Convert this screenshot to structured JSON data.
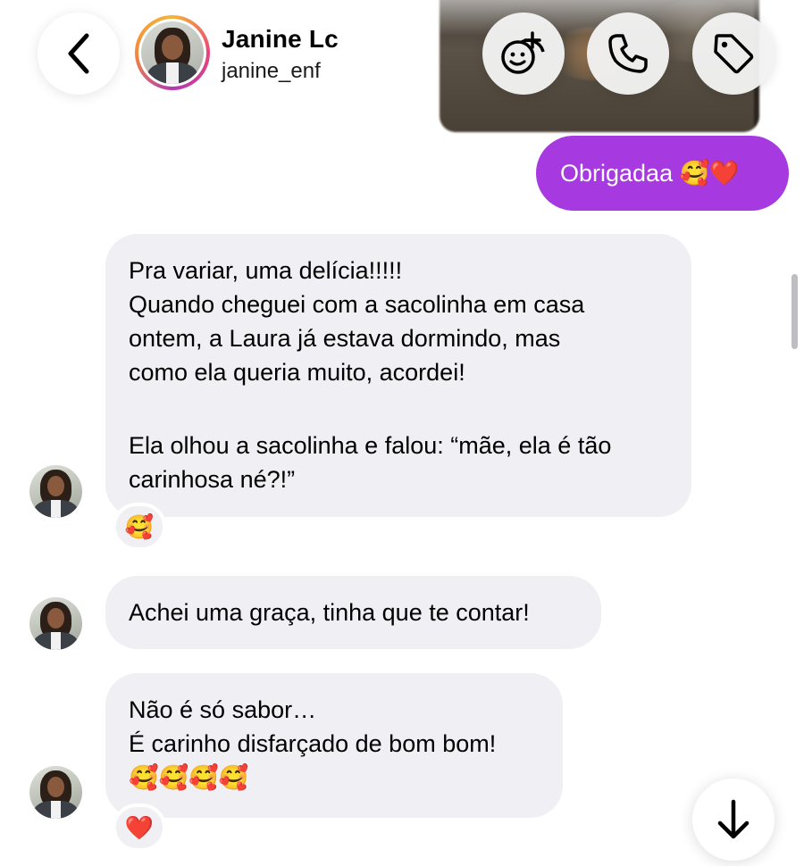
{
  "header": {
    "contact_name": "Janine Lc",
    "contact_handle": "janine_enf",
    "icons": [
      "back-chevron-icon",
      "avatar-sticker-icon",
      "phone-icon",
      "tag-icon"
    ]
  },
  "messages": {
    "outgoing_1": "Obrigadaa 🥰❤️",
    "incoming_1": {
      "lines": [
        "Pra variar, uma delícia!!!!!",
        "Quando cheguei com a sacolinha em casa",
        "ontem, a Laura já estava dormindo, mas",
        "como ela queria muito, acordei!",
        "Ela olhou a sacolinha e falou: “mãe, ela é tão",
        "carinhosa né?!”"
      ],
      "reaction": "🥰"
    },
    "incoming_2": "Achei uma graça, tinha que te contar!",
    "incoming_3": {
      "lines": [
        "Não é só sabor…",
        "É carinho disfarçado de bom bom!",
        "🥰🥰🥰🥰"
      ],
      "reaction": "❤️"
    }
  },
  "colors": {
    "outgoing_bubble": "#a639e0",
    "incoming_bubble": "#efeff4",
    "background": "#ffffff"
  }
}
